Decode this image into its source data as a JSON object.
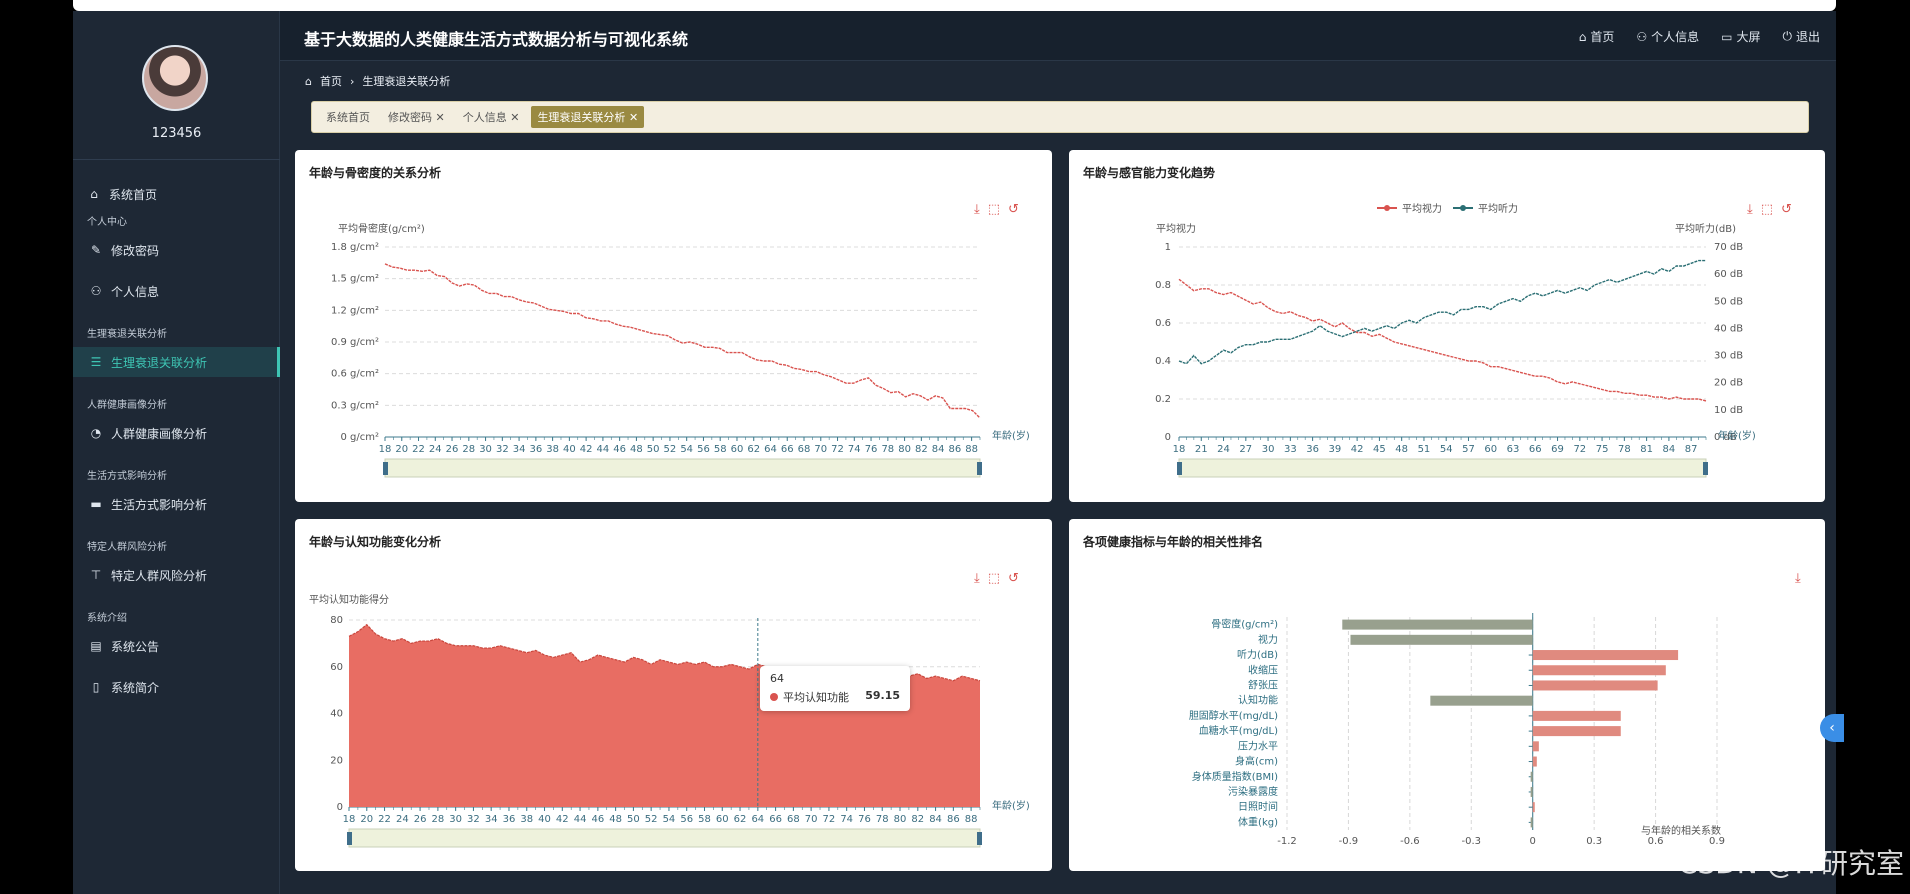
{
  "sidebar": {
    "username": "123456",
    "items": [
      {
        "label": "系统首页",
        "icon": "home-icon"
      },
      {
        "group": "个人中心"
      },
      {
        "label": "修改密码",
        "icon": "edit-icon"
      },
      {
        "label": "个人信息",
        "icon": "user-icon"
      },
      {
        "group": "生理衰退关联分析"
      },
      {
        "label": "生理衰退关联分析",
        "icon": "sliders-icon",
        "active": true
      },
      {
        "group": "人群健康画像分析"
      },
      {
        "label": "人群健康画像分析",
        "icon": "gauge-icon"
      },
      {
        "group": "生活方式影响分析"
      },
      {
        "label": "生活方式影响分析",
        "icon": "monitor-icon"
      },
      {
        "group": "特定人群风险分析"
      },
      {
        "label": "特定人群风险分析",
        "icon": "stamp-icon"
      },
      {
        "group": "系统介绍"
      },
      {
        "label": "系统公告",
        "icon": "clipboard-icon"
      },
      {
        "label": "系统简介",
        "icon": "phone-icon"
      }
    ]
  },
  "header": {
    "title": "基于大数据的人类健康生活方式数据分析与可视化系统",
    "nav": [
      "首页",
      "个人信息",
      "大屏",
      "退出"
    ]
  },
  "breadcrumb": {
    "home": "首页",
    "current": "生理衰退关联分析"
  },
  "tags": [
    {
      "label": "系统首页",
      "closable": false,
      "active": false
    },
    {
      "label": "修改密码",
      "closable": true,
      "active": false
    },
    {
      "label": "个人信息",
      "closable": true,
      "active": false
    },
    {
      "label": "生理衰退关联分析",
      "closable": true,
      "active": true
    }
  ],
  "colors": {
    "red": "#d9534f",
    "teal": "#2b6f74",
    "bar_pos": "#e08a7f",
    "bar_neg": "#98a08e",
    "accent": "#3ec5b4"
  },
  "chart_data": [
    {
      "type": "line",
      "title": "年龄与骨密度的关系分析",
      "ylabel": "平均骨密度(g/cm²)",
      "xlabel": "年龄(岁)",
      "ylim": [
        0,
        1.8
      ],
      "yticks": [
        "0 g/cm²",
        "0.3 g/cm²",
        "0.6 g/cm²",
        "0.9 g/cm²",
        "1.2 g/cm²",
        "1.5 g/cm²",
        "1.8 g/cm²"
      ],
      "xticks": [
        "18",
        "20",
        "22",
        "24",
        "26",
        "28",
        "30",
        "32",
        "34",
        "36",
        "38",
        "40",
        "42",
        "44",
        "46",
        "48",
        "50",
        "52",
        "54",
        "56",
        "58",
        "60",
        "62",
        "64",
        "66",
        "68",
        "70",
        "72",
        "74",
        "76",
        "78",
        "80",
        "82",
        "84",
        "86",
        "88"
      ],
      "x_range": [
        18,
        89
      ],
      "series": [
        {
          "values": [
            1.64,
            1.61,
            1.6,
            1.58,
            1.58,
            1.57,
            1.58,
            1.53,
            1.52,
            1.46,
            1.43,
            1.45,
            1.44,
            1.39,
            1.36,
            1.36,
            1.33,
            1.33,
            1.3,
            1.28,
            1.27,
            1.24,
            1.21,
            1.2,
            1.19,
            1.17,
            1.17,
            1.13,
            1.12,
            1.1,
            1.1,
            1.07,
            1.05,
            1.04,
            1.02,
            1.0,
            0.98,
            0.97,
            0.96,
            0.92,
            0.89,
            0.9,
            0.88,
            0.85,
            0.85,
            0.84,
            0.8,
            0.8,
            0.8,
            0.76,
            0.73,
            0.72,
            0.72,
            0.69,
            0.68,
            0.65,
            0.64,
            0.62,
            0.62,
            0.59,
            0.57,
            0.54,
            0.51,
            0.51,
            0.54,
            0.56,
            0.49,
            0.46,
            0.42,
            0.43,
            0.38,
            0.41,
            0.39,
            0.35,
            0.39,
            0.37,
            0.27,
            0.27,
            0.27,
            0.25,
            0.18
          ]
        }
      ]
    },
    {
      "type": "line",
      "title": "年龄与感官能力变化趋势",
      "ylabel_left": "平均视力",
      "ylabel_right": "平均听力(dB)",
      "xlabel": "年龄(岁)",
      "ylim_left": [
        0,
        1
      ],
      "ylim_right": [
        0,
        70
      ],
      "yticks_left": [
        "0",
        "0.2",
        "0.4",
        "0.6",
        "0.8",
        "1"
      ],
      "yticks_right": [
        "0 dB",
        "10 dB",
        "20 dB",
        "30 dB",
        "40 dB",
        "50 dB",
        "60 dB",
        "70 dB"
      ],
      "xticks": [
        "18",
        "21",
        "24",
        "27",
        "30",
        "33",
        "36",
        "39",
        "42",
        "45",
        "48",
        "51",
        "54",
        "57",
        "60",
        "63",
        "66",
        "69",
        "72",
        "75",
        "78",
        "81",
        "84",
        "87"
      ],
      "x_range": [
        18,
        89
      ],
      "series": [
        {
          "name": "平均视力",
          "axis": "left",
          "values": [
            0.83,
            0.8,
            0.77,
            0.78,
            0.78,
            0.76,
            0.75,
            0.76,
            0.74,
            0.72,
            0.7,
            0.71,
            0.68,
            0.66,
            0.65,
            0.66,
            0.64,
            0.63,
            0.61,
            0.62,
            0.6,
            0.58,
            0.6,
            0.57,
            0.55,
            0.55,
            0.53,
            0.54,
            0.52,
            0.5,
            0.49,
            0.48,
            0.47,
            0.46,
            0.45,
            0.44,
            0.43,
            0.42,
            0.41,
            0.4,
            0.4,
            0.39,
            0.37,
            0.37,
            0.36,
            0.35,
            0.34,
            0.33,
            0.32,
            0.32,
            0.31,
            0.29,
            0.28,
            0.29,
            0.28,
            0.27,
            0.26,
            0.25,
            0.24,
            0.24,
            0.23,
            0.23,
            0.22,
            0.22,
            0.21,
            0.21,
            0.2,
            0.21,
            0.2,
            0.2,
            0.2,
            0.19
          ]
        },
        {
          "name": "平均听力",
          "axis": "right",
          "values": [
            28,
            27,
            30,
            27,
            28,
            30,
            32,
            31,
            33,
            34,
            34,
            35,
            35,
            36,
            36,
            36,
            37,
            38,
            39,
            41,
            39,
            38,
            37,
            38,
            39,
            40,
            39,
            40,
            41,
            40,
            42,
            43,
            42,
            44,
            45,
            46,
            46,
            45,
            47,
            47,
            48,
            48,
            47,
            49,
            50,
            51,
            50,
            52,
            53,
            52,
            53,
            54,
            53,
            54,
            55,
            54,
            56,
            57,
            58,
            57,
            58,
            59,
            60,
            61,
            60,
            62,
            61,
            63,
            63,
            64,
            65,
            65
          ]
        }
      ]
    },
    {
      "type": "area",
      "title": "年龄与认知功能变化分析",
      "ylabel": "平均认知功能得分",
      "xlabel": "年龄(岁)",
      "ylim": [
        0,
        80
      ],
      "yticks": [
        "0",
        "20",
        "40",
        "60",
        "80"
      ],
      "xticks": [
        "18",
        "20",
        "22",
        "24",
        "26",
        "28",
        "30",
        "32",
        "34",
        "36",
        "38",
        "40",
        "42",
        "44",
        "46",
        "48",
        "50",
        "52",
        "54",
        "56",
        "58",
        "60",
        "62",
        "64",
        "66",
        "68",
        "70",
        "72",
        "74",
        "76",
        "78",
        "80",
        "82",
        "84",
        "86",
        "88"
      ],
      "x_range": [
        18,
        89
      ],
      "series": [
        {
          "name": "平均认知功能",
          "values": [
            73,
            75,
            78,
            74,
            72,
            71,
            72,
            70,
            71,
            71,
            72,
            70,
            69,
            69,
            69,
            68,
            68,
            69,
            68,
            67,
            66,
            67,
            65,
            64,
            65,
            66,
            62,
            63,
            65,
            64,
            63,
            62,
            64,
            63,
            61,
            63,
            62,
            61,
            62,
            61,
            62,
            60,
            60,
            61,
            60,
            59,
            61,
            60,
            60,
            59.15,
            60,
            59,
            58,
            60,
            58,
            59,
            57,
            59,
            58,
            57,
            58,
            56,
            58,
            56,
            57,
            55,
            56,
            55,
            54,
            56,
            55,
            54
          ]
        }
      ],
      "tooltip": {
        "x": "64",
        "series": "平均认知功能",
        "value": "59.15"
      }
    },
    {
      "type": "bar",
      "orientation": "horizontal",
      "title": "各项健康指标与年龄的相关性排名",
      "xlabel": "与年龄的相关系数",
      "xlim": [
        -1.2,
        0.9
      ],
      "xticks": [
        "-1.2",
        "-0.9",
        "-0.6",
        "-0.3",
        "0",
        "0.3",
        "0.6",
        "0.9"
      ],
      "categories": [
        "骨密度(g/cm²)",
        "视力",
        "听力(dB)",
        "收缩压",
        "舒张压",
        "认知功能",
        "胆固醇水平(mg/dL)",
        "血糖水平(mg/dL)",
        "压力水平",
        "身高(cm)",
        "身体质量指数(BMI)",
        "污染暴露度",
        "日照时间",
        "体重(kg)"
      ],
      "values": [
        -0.93,
        -0.89,
        0.71,
        0.65,
        0.61,
        -0.5,
        0.43,
        0.43,
        0.03,
        0.02,
        -0.01,
        -0.01,
        0.01,
        -0.01
      ]
    }
  ],
  "watermark": "CSDN @IT研究室"
}
